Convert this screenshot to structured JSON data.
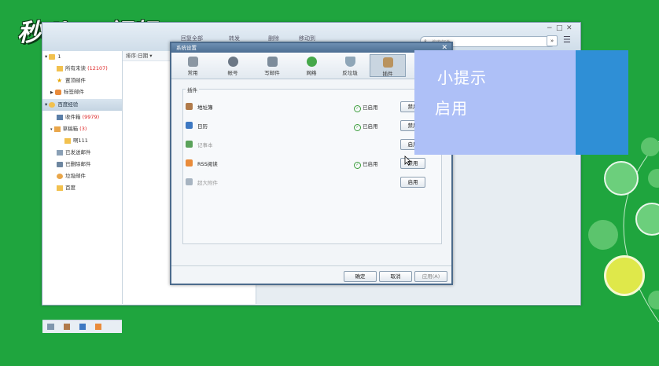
{
  "watermark": {
    "text": "秒dòng视频"
  },
  "window": {
    "toolbar": [
      "回复全部",
      "转发",
      "删除",
      "移动到"
    ],
    "search_placeholder": "搜索邮件",
    "controls": [
      "−",
      "□",
      "✕"
    ]
  },
  "sidebar": {
    "account1": "1",
    "items1": [
      {
        "label": "所有未读",
        "count": "(12107)"
      },
      {
        "label": "置顶邮件",
        "count": ""
      },
      {
        "label": "标签邮件",
        "count": ""
      }
    ],
    "account2": "百度经验",
    "items2": [
      {
        "label": "收件箱",
        "count": "(9979)"
      },
      {
        "label": "草稿箱",
        "count": "(3)"
      },
      {
        "label": "啊111",
        "count": ""
      },
      {
        "label": "已发送邮件",
        "count": ""
      },
      {
        "label": "已删除邮件",
        "count": ""
      },
      {
        "label": "垃圾邮件",
        "count": ""
      },
      {
        "label": "百度",
        "count": ""
      }
    ]
  },
  "list": {
    "sort_label": "排序:日期 ▾"
  },
  "dialog": {
    "title": "系统设置",
    "close": "✕",
    "tabs": [
      "常用",
      "帐号",
      "写邮件",
      "网络",
      "反垃圾",
      "插件",
      "高级"
    ],
    "selected_tab": "插件",
    "section_label": "插件",
    "plugins": [
      {
        "name": "地址簿",
        "status": "已启用",
        "button": "禁用",
        "enabled": true
      },
      {
        "name": "日历",
        "status": "已启用",
        "button": "禁用",
        "enabled": true
      },
      {
        "name": "记事本",
        "status": "",
        "button": "启用",
        "enabled": false
      },
      {
        "name": "RSS阅读",
        "status": "已启用",
        "button": "禁用",
        "enabled": true
      },
      {
        "name": "超大附件",
        "status": "",
        "button": "启用",
        "enabled": false
      }
    ],
    "footer": {
      "ok": "确定",
      "cancel": "取消",
      "apply": "应用(A)"
    }
  },
  "tip": {
    "title": "小提示",
    "text": "启用"
  },
  "colors": {
    "background": "#1fa53e",
    "tip": "#bac4fa",
    "dialog_border": "#4c6b8c"
  }
}
